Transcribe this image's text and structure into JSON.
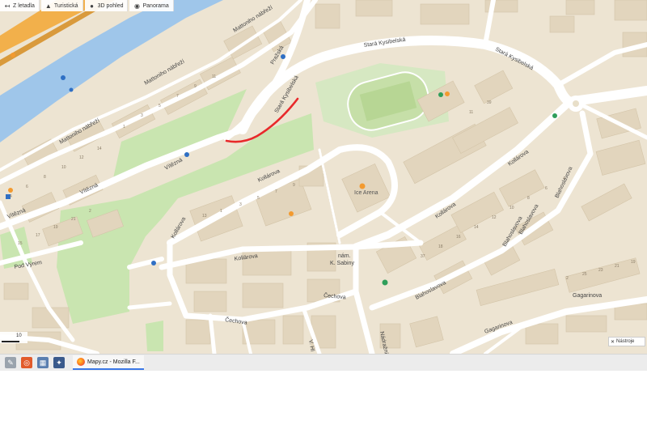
{
  "toolbar": {
    "back_label": "Z letadla",
    "tourist_label": "Turistická",
    "view3d_label": "3D pohled",
    "panorama_label": "Panorama"
  },
  "map": {
    "streets": {
      "mattoniho_1": "Mattoniho nábřeží",
      "mattoniho_2": "Mattoniho nábřeží",
      "mattoniho_3": "Mattoniho nábřeží",
      "vitezna_1": "Vítězná",
      "vitezna_2": "Vítězná",
      "vitezna_3": "Vítězná",
      "stara_kysibelska_1": "Stará Kysibelská",
      "stara_kysibelska_2": "Stará Kysibelská",
      "stara_kysibelska_3": "Stará Kysibelská",
      "prazska": "Pražská",
      "kollarova_1": "Kollárova",
      "kollarova_2": "Kollárova",
      "kollarova_3": "Kollárova",
      "kollarova_4": "Kollárova",
      "kollarova_5": "Kollárova",
      "blahoslavova_1": "Blahoslavova",
      "blahoslavova_2": "Blahoslavova",
      "blahoslavova_3": "Blahoslavova",
      "blahoslavova_4": "Blahoslavova",
      "gagarinova_1": "Gagarinova",
      "gagarinova_2": "Gagarinova",
      "cechova_1": "Čechova",
      "cechova_2": "Čechova",
      "pod_vyrem": "Pod Výrem",
      "nam_k_sabiny_1": "nám.",
      "nam_k_sabiny_2": "K. Sabiny",
      "nadrazni": "Nádražní",
      "v_hl": "V. Hl"
    },
    "poi": {
      "ice_rink": "Ice Arena"
    },
    "house_numbers": [
      "11",
      "9",
      "7",
      "5",
      "3",
      "1",
      "14",
      "12",
      "10",
      "8",
      "6",
      "4",
      "2",
      "21",
      "19",
      "17",
      "15",
      "13",
      "1",
      "3",
      "5",
      "7",
      "9",
      "11",
      "39",
      "37",
      "18",
      "16",
      "14",
      "12",
      "10",
      "8",
      "6",
      "4",
      "2",
      "25",
      "23",
      "21",
      "19"
    ],
    "scale_label": "10",
    "share_label": "Nástroje"
  },
  "taskbar": {
    "active_task_label": "Mapy.cz - Mozilla F..."
  },
  "colors": {
    "land": "#ede4d2",
    "building": "#e2d5bd",
    "park": "#c9e5b0",
    "water": "#9fc6ea",
    "road": "#ffffff",
    "highway": "#f2b04b",
    "route": "#e8292b"
  }
}
